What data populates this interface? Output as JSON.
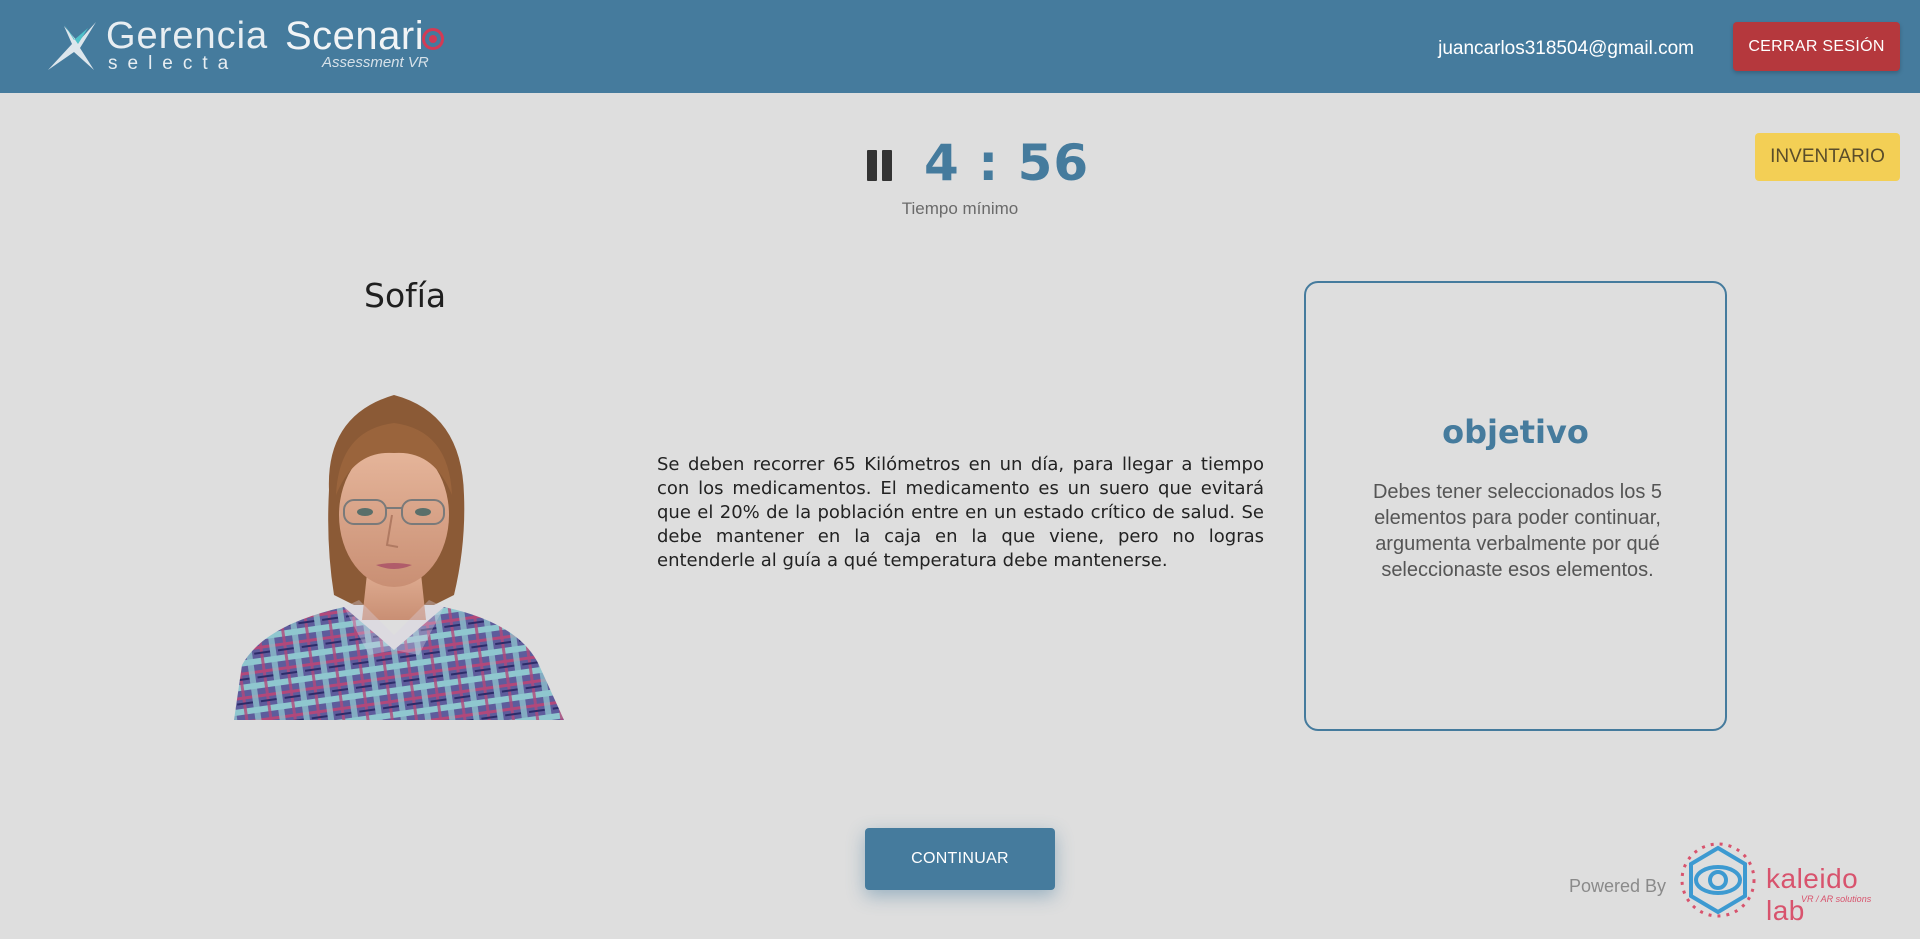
{
  "header": {
    "brand1": {
      "line1": "Gerencia",
      "line2": "selecta"
    },
    "brand2": {
      "line1": "Scenari",
      "line2": "Assessment VR"
    },
    "user_email": "juancarlos318504@gmail.com",
    "logout_label": "CERRAR SESIÓN"
  },
  "timer": {
    "value": "4 : 56",
    "caption": "Tiempo mínimo"
  },
  "inventory_label": "INVENTARIO",
  "character": {
    "name": "Sofía",
    "description": "Se deben recorrer 65 Kilómetros en un día, para llegar a tiempo con los medicamentos. El medicamento es un suero que evitará que el 20% de la población entre en un estado crítico de salud. Se debe mantener en la caja en la que viene, pero no logras entenderle al guía a qué temperatura debe mantenerse."
  },
  "objective": {
    "title": "objetivo",
    "text": "Debes tener seleccionados los 5 elementos para poder continuar, argumenta verbalmente por qué seleccionaste esos elementos."
  },
  "continue_label": "CONTINUAR",
  "footer": {
    "powered_by": "Powered By",
    "partner_name": "kaleido lab",
    "partner_sub": "VR / AR solutions"
  },
  "colors": {
    "header_bg": "#457b9d",
    "accent": "#457b9d",
    "logout_bg": "#b5383d",
    "inventory_bg": "#f3cf55",
    "page_bg": "#dedede",
    "partner": "#d8536d"
  },
  "icons": [
    "gerencia-selecta-logo-icon",
    "pause-icon",
    "kaleido-eye-icon"
  ]
}
